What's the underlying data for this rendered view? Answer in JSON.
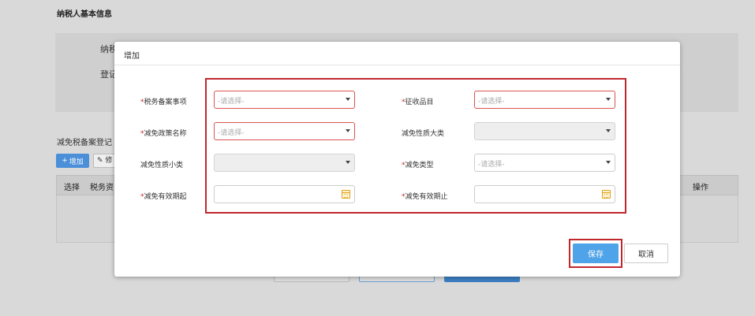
{
  "background": {
    "section_title": "纳税人基本信息",
    "info_label_1": "纳税",
    "info_label_2": "登记",
    "list_title": "减免税备案登记",
    "add_button": "增加",
    "edit_button": "修",
    "table_headers": [
      "选择",
      "税务资",
      "操作"
    ]
  },
  "dialog": {
    "title": "增加",
    "fields": {
      "tax_filing_item": {
        "label": "税务备案事项",
        "required": true,
        "placeholder": "-请选择-"
      },
      "levy_item": {
        "label": "征收品目",
        "required": true,
        "placeholder": "-请选择-"
      },
      "exemption_policy_name": {
        "label": "减免政策名称",
        "required": true,
        "placeholder": "-请选择-"
      },
      "exemption_nature_major": {
        "label": "减免性质大类",
        "required": false,
        "placeholder": ""
      },
      "exemption_nature_minor": {
        "label": "减免性质小类",
        "required": false,
        "placeholder": ""
      },
      "exemption_type": {
        "label": "减免类型",
        "required": true,
        "placeholder": "-请选择-"
      },
      "valid_from": {
        "label": "减免有效期起",
        "required": true,
        "placeholder": ""
      },
      "valid_to": {
        "label": "减免有效期止",
        "required": true,
        "placeholder": ""
      }
    },
    "required_mark": "*",
    "save_label": "保存",
    "cancel_label": "取消"
  },
  "colors": {
    "highlight": "#c0272d",
    "primary_button": "#4fa3e8",
    "error_border": "#d9534f"
  }
}
